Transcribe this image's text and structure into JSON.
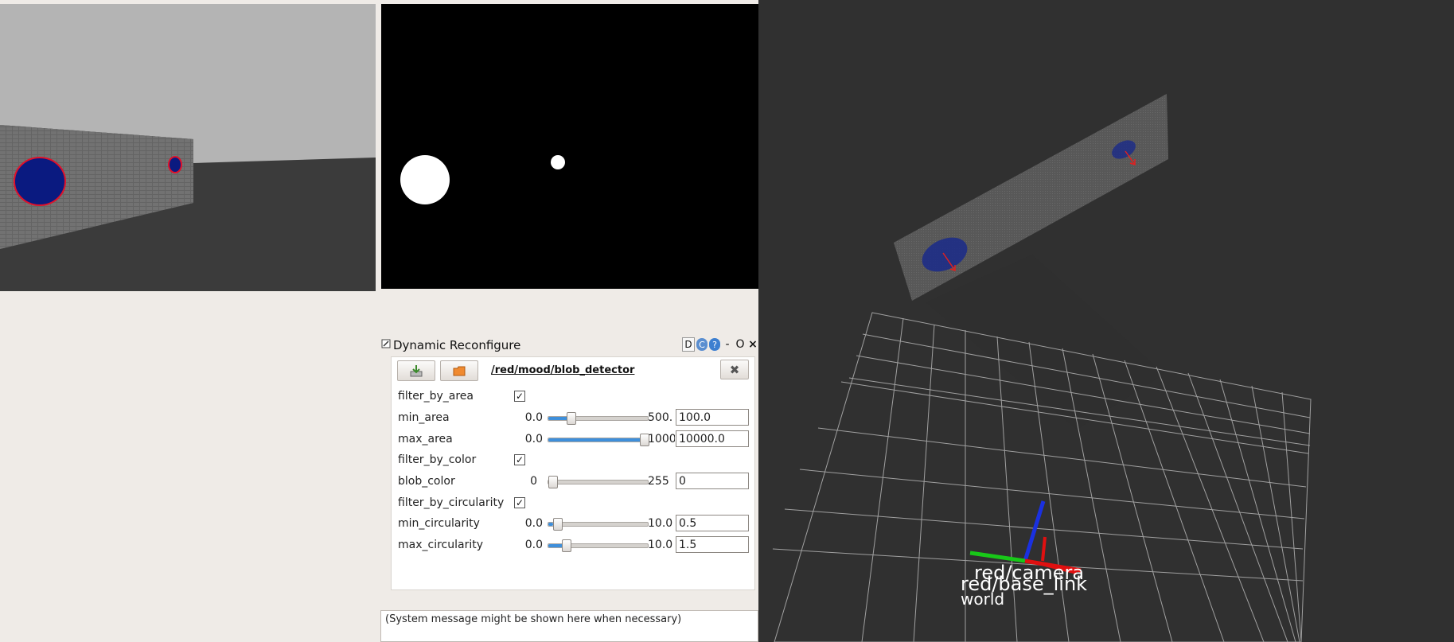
{
  "dynamic_reconfigure": {
    "title": "Dynamic Reconfigure",
    "title_buttons": [
      "D",
      "C",
      "?",
      "-",
      "O",
      "×"
    ],
    "node_path": "/red/mood/blob_detector",
    "params": [
      {
        "name": "filter_by_area",
        "type": "bool",
        "checked": true
      },
      {
        "name": "min_area",
        "type": "slider",
        "min": "0.0",
        "max": "500.",
        "value": "100.0",
        "fraction": 0.2
      },
      {
        "name": "max_area",
        "type": "slider",
        "min": "0.0",
        "max": "1000",
        "value": "10000.0",
        "fraction": 1.0
      },
      {
        "name": "filter_by_color",
        "type": "bool",
        "checked": true
      },
      {
        "name": "blob_color",
        "type": "slider",
        "min": "0",
        "max": "255",
        "value": "0",
        "fraction": 0.0
      },
      {
        "name": "filter_by_circularity",
        "type": "bool",
        "checked": true
      },
      {
        "name": "min_circularity",
        "type": "slider",
        "min": "0.0",
        "max": "10.0",
        "value": "0.5",
        "fraction": 0.05
      },
      {
        "name": "max_circularity",
        "type": "slider",
        "min": "0.0",
        "max": "10.0",
        "value": "1.5",
        "fraction": 0.15
      }
    ]
  },
  "system_message": "(System message might be shown here when necessary)",
  "rviz": {
    "frame_labels": {
      "camera": "red/camera",
      "base_link": "red/base_link",
      "world": "world"
    }
  },
  "colors": {
    "blob_blue": "#0a1a80",
    "blob_outline": "#e0102a",
    "slider_fill": "#3e8fdb",
    "rviz_background": "#303030"
  }
}
